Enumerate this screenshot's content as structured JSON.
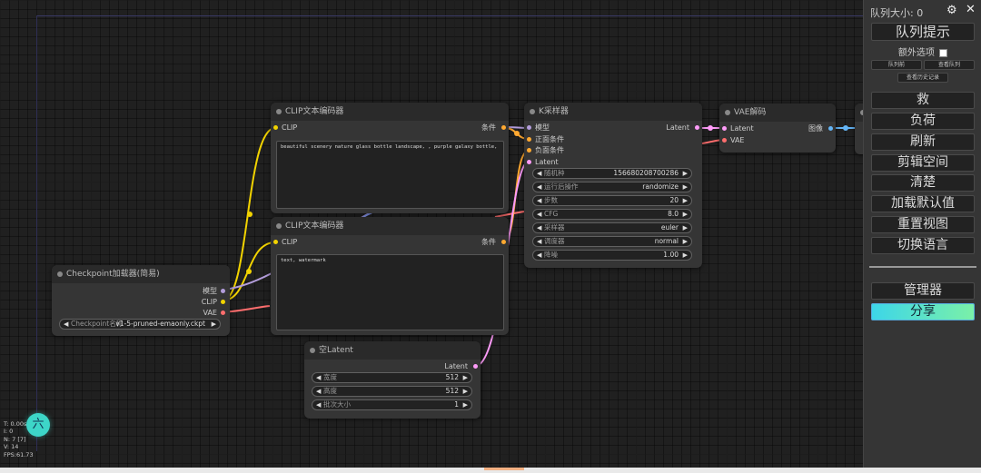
{
  "queue": {
    "size_label": "队列大小: 0",
    "prompt_button": "队列提示",
    "extra_options_label": "额外选项",
    "queue_front": "队列前",
    "view_queue": "查看队列",
    "view_history": "查看历史记录",
    "buttons": [
      "救",
      "负荷",
      "刷新",
      "剪辑空间",
      "清楚",
      "加载默认值",
      "重置视图",
      "切换语言"
    ],
    "manager": "管理器",
    "share": "分享"
  },
  "nodes": {
    "checkpoint": {
      "title": "Checkpoint加载器(简易)",
      "out_model": "模型",
      "out_clip": "CLIP",
      "out_vae": "VAE",
      "ckpt_label": "Checkpoint名称",
      "ckpt_value": "v1-5-pruned-emaonly.ckpt"
    },
    "clip_pos": {
      "title": "CLIP文本编码器",
      "in_clip": "CLIP",
      "out_cond": "条件",
      "text": "beautiful scenery nature glass bottle landscape, , purple galaxy bottle,"
    },
    "clip_neg": {
      "title": "CLIP文本编码器",
      "in_clip": "CLIP",
      "out_cond": "条件",
      "text": "text, watermark"
    },
    "ksampler": {
      "title": "K采样器",
      "in_model": "模型",
      "in_pos": "正面条件",
      "in_neg": "负面条件",
      "in_latent": "Latent",
      "out_latent": "Latent",
      "widgets": [
        {
          "label": "随机种",
          "value": "156680208700286"
        },
        {
          "label": "运行后操作",
          "value": "randomize"
        },
        {
          "label": "步数",
          "value": "20"
        },
        {
          "label": "CFG",
          "value": "8.0"
        },
        {
          "label": "采样器",
          "value": "euler"
        },
        {
          "label": "调度器",
          "value": "normal"
        },
        {
          "label": "降噪",
          "value": "1.00"
        }
      ]
    },
    "vae": {
      "title": "VAE解码",
      "in_latent": "Latent",
      "in_vae": "VAE",
      "out_image": "图像"
    },
    "empty_latent": {
      "title": "空Latent",
      "out_latent": "Latent",
      "widgets": [
        {
          "label": "宽度",
          "value": "512"
        },
        {
          "label": "高度",
          "value": "512"
        },
        {
          "label": "批次大小",
          "value": "1"
        }
      ]
    }
  },
  "stats": {
    "t": "T: 0.00s",
    "i": "I: 0",
    "n": "N: 7 [7]",
    "v": "V: 14",
    "fps": "FPS:61.73"
  },
  "avatar_char": "六",
  "colors": {
    "clip": "#f2d300",
    "conditioning": "#ffa931",
    "model": "#b39ddb",
    "vae": "#ff6e6e",
    "latent": "#ff9cf9",
    "image": "#64b5f6",
    "share": "#3dd6e8"
  }
}
